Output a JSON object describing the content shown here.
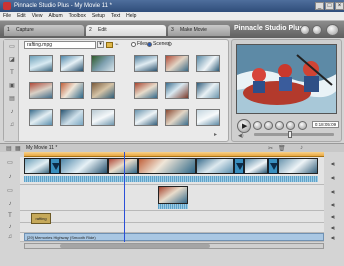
{
  "window": {
    "title": "Pinnacle Studio Plus - My Movie 11 *",
    "minimize": "_",
    "maximize": "□",
    "close": "×"
  },
  "menu": [
    "File",
    "Edit",
    "View",
    "Album",
    "Toolbox",
    "Setup",
    "Text",
    "Help"
  ],
  "tabs": [
    {
      "number": "1",
      "label": "Capture"
    },
    {
      "number": "2",
      "label": "Edit"
    },
    {
      "number": "3",
      "label": "Make Movie"
    }
  ],
  "brand": "Pinnacle Studio Plus",
  "album": {
    "file_name": "rafting.mpg",
    "view_options": [
      "Files",
      "Scenes"
    ]
  },
  "preview": {
    "timecode": "0:18:05:09"
  },
  "timeline": {
    "movie_title": "My Movie 11 *"
  },
  "tracks": {
    "title_clip": "rafting",
    "audio_clip": "[29] Memories Highway (Smooth Ride)"
  },
  "colors": {
    "accent": "#e9a640",
    "audio": "#a9c7e3",
    "playhead": "#2a4fd8"
  }
}
